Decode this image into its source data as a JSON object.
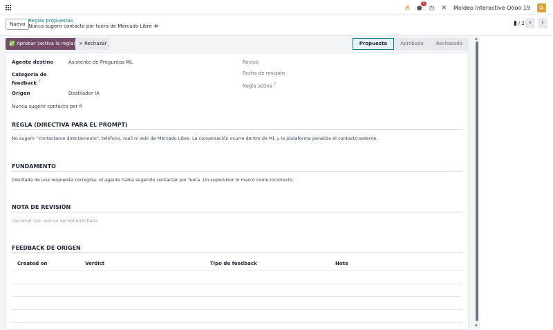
{
  "navbar": {
    "company": "Moldeo Interactive Odoo 19",
    "avatar_letter": "A",
    "chat_badge": "1"
  },
  "control_panel": {
    "new_button": "Nuevo",
    "breadcrumb": "Reglas propuestas",
    "record_title": "Nunca sugerir contacto por fuera de Mercado Libre",
    "pager_value": "1 / 2"
  },
  "statusbar": {
    "approve_button": "✅ Aprobar (activa la regla)",
    "reject_button": "× Rechazar",
    "stages": [
      "Propuesta",
      "Aprobada",
      "Rechazada"
    ],
    "active_stage": "Propuesta"
  },
  "form": {
    "agent_label": "Agente destino",
    "agent_value": "Asistente de Preguntas ML",
    "category_label_1": "Categoría de",
    "category_label_2": "feedback",
    "origin_label": "Origen",
    "origin_value": "Destilador IA",
    "name_value": "Nunca sugerir contacto por fi",
    "reviewed_label": "Revisó",
    "review_date_label": "Fecha de revisión",
    "active_rule_label": "Regla activa",
    "help_mark": "?"
  },
  "sections": {
    "rule_title": "REGLA (DIRECTIVA PARA EL PROMPT)",
    "rule_text": "No sugerir \"contactame directamente\", teléfono, mail ni salir de Mercado Libre. La conversación ocurre dentro de ML y la plataforma penaliza el contacto externo.",
    "basis_title": "FUNDAMENTO",
    "basis_text": "Destilada de una respuesta corregida: el agente había sugerido contactar por fuera. Un supervisor lo marcó como incorrecto.",
    "review_note_title": "NOTA DE REVISIÓN",
    "review_note_placeholder": "Opcional: por qué se aprueba/rechaza",
    "origin_feedback_title": "FEEDBACK DE ORIGEN"
  },
  "table": {
    "columns": [
      "Created on",
      "Verdict",
      "Tipo de feedback",
      "Note"
    ]
  },
  "colors": {
    "brand": "#714b67",
    "accent": "#017e84"
  }
}
